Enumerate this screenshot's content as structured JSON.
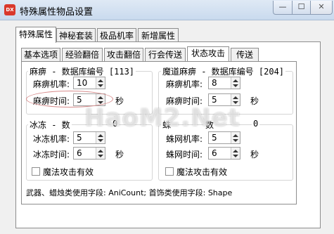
{
  "window": {
    "title": "特殊属性物品设置",
    "app_icon_text": "DX",
    "minimize_glyph": "—",
    "maximize_glyph": "☐",
    "close_glyph": "✕"
  },
  "outer_tabs": [
    "特殊属性",
    "神秘套装",
    "极品机率",
    "新增属性"
  ],
  "inner_tabs": [
    "基本选项",
    "经验翻倍",
    "攻击翻倍",
    "行会传送",
    "状态攻击",
    "传送"
  ],
  "groups": [
    {
      "title": "麻痹 - 数据库编号 [113]",
      "rate_label": "麻痹机率:",
      "rate_value": "10",
      "time_label": "麻痹时间:",
      "time_value": "5",
      "time_unit": "秒"
    },
    {
      "title": "魔道麻痹 - 数据库编号 [204]",
      "rate_label": "麻痹机率:",
      "rate_value": "8",
      "time_label": "麻痹时间:",
      "time_value": "5",
      "time_unit": "秒"
    },
    {
      "title": "冰冻 - 数",
      "title_tail": "0",
      "rate_label": "冰冻机率:",
      "rate_value": "5",
      "time_label": "冰冻时间:",
      "time_value": "6",
      "time_unit": "秒",
      "checkbox_label": "魔法攻击有效",
      "checked": false
    },
    {
      "title": "蛛",
      "title_tail": "数",
      "title_end": "0",
      "rate_label": "蛛网机率:",
      "rate_value": "5",
      "time_label": "蛛网时间:",
      "time_value": "6",
      "time_unit": "秒",
      "checkbox_label": "魔法攻击有效",
      "checked": false
    }
  ],
  "footer": "武器、蜡烛类使用字段: AniCount; 首饰类使用字段: Shape",
  "watermark": "HaoM2.Net"
}
